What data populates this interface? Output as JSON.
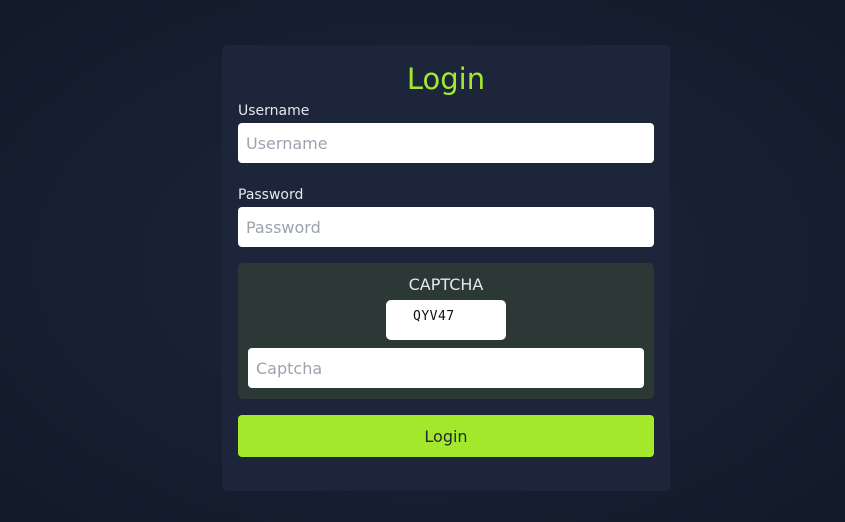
{
  "login_form": {
    "title": "Login",
    "username": {
      "label": "Username",
      "value": "",
      "placeholder": "Username"
    },
    "password": {
      "label": "Password",
      "value": "",
      "placeholder": "Password"
    },
    "captcha": {
      "title": "CAPTCHA",
      "code": "QYV47",
      "value": "",
      "placeholder": "Captcha"
    },
    "submit_label": "Login"
  },
  "colors": {
    "background": "#162031",
    "card": "#1c2539",
    "accent": "#a3e635",
    "captcha_panel": "#2b3835",
    "button": "#a3e82a"
  }
}
